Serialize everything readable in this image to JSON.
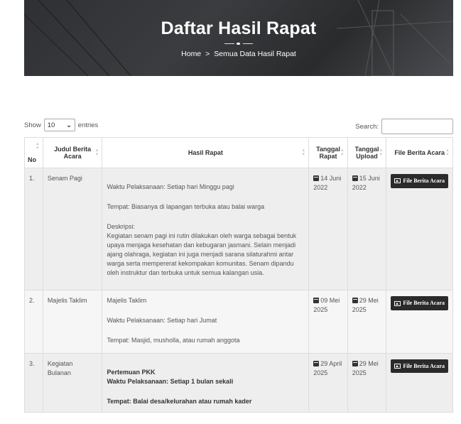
{
  "hero": {
    "title": "Daftar Hasil Rapat",
    "breadcrumb": {
      "home": "Home",
      "separator": ">",
      "current": "Semua Data Hasil Rapat"
    }
  },
  "controls": {
    "show_label": "Show",
    "entries_value": "10",
    "entries_label": "entries",
    "search_label": "Search:",
    "search_value": ""
  },
  "table": {
    "headers": {
      "no": "No",
      "judul": "Judul Berita Acara",
      "hasil": "Hasil Rapat",
      "tgl_rapat": "Tanggal Rapat",
      "tgl_upload": "Tanggal Upload",
      "file": "File Berita Acara"
    },
    "file_button_label": "File Berita Acara",
    "rows": [
      {
        "no": "1.",
        "judul": "Senam Pagi",
        "hasil": {
          "p1": "Waktu Pelaksanaan: Setiap hari Minggu pagi",
          "p2": "Tempat: Biasanya di lapangan terbuka atau balai warga",
          "p3_title": "Deskripsi:",
          "p3_body": "Kegiatan senam pagi ini rutin dilakukan oleh warga sebagai bentuk upaya menjaga kesehatan dan kebugaran jasmani. Selain menjadi ajang olahraga, kegiatan ini juga menjadi sarana silaturahmi antar warga serta mempererat kekompakan komunitas. Senam dipandu oleh instruktur dan terbuka untuk semua kalangan usia."
        },
        "tgl_rapat": "14 Juni 2022",
        "tgl_upload": "15 Juni 2022"
      },
      {
        "no": "2.",
        "judul": "Majelis Taklim",
        "hasil": {
          "p1": "Majelis Taklim",
          "p2": "Waktu Pelaksanaan: Setiap hari Jumat",
          "p3": "Tempat: Masjid, musholla, atau rumah anggota"
        },
        "tgl_rapat": "09 Mei 2025",
        "tgl_upload": "29 Mei 2025"
      },
      {
        "no": "3.",
        "judul": "Kegiatan Bulanan",
        "hasil": {
          "p1": "Pertemuan PKK",
          "p2": "Waktu Pelaksanaan: Setiap 1 bulan sekali",
          "p3": "Tempat: Balai desa/kelurahan atau rumah kader"
        },
        "tgl_rapat": "29 April 2025",
        "tgl_upload": "29 Mei 2025"
      }
    ]
  }
}
